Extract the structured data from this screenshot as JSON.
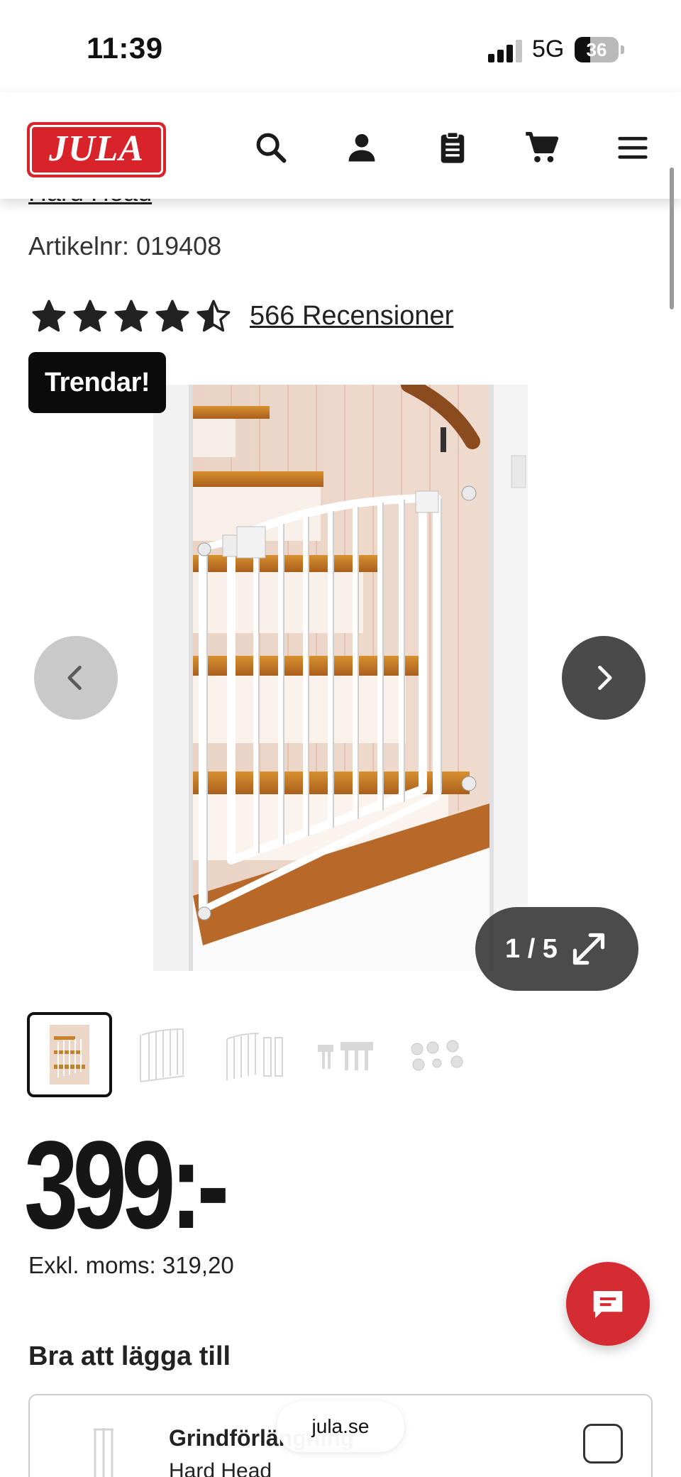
{
  "status_bar": {
    "time": "11:39",
    "network": "5G",
    "battery": "36",
    "battery_fraction": 0.36
  },
  "header": {
    "logo_text": "JULA",
    "icons": [
      "search-icon",
      "account-icon",
      "shopping-list-icon",
      "cart-icon",
      "menu-icon"
    ],
    "accent_color": "#d8232a"
  },
  "product": {
    "brand": "Hard Head",
    "article_number": "Artikelnr: 019408",
    "rating": 4.5,
    "reviews_link": "566 Recensioner"
  },
  "gallery": {
    "badge": "Trendar!",
    "counter": "1 / 5",
    "current": 1,
    "total": 5,
    "thumbnail_count": 5
  },
  "price": {
    "value": "399:-",
    "vat_text": "Exkl. moms: 319,20"
  },
  "addons": {
    "title": "Bra att lägga till",
    "items": [
      {
        "name": "Grindförlängning",
        "brand": "Hard Head",
        "checked": false
      }
    ]
  },
  "browser": {
    "url": "jula.se"
  }
}
